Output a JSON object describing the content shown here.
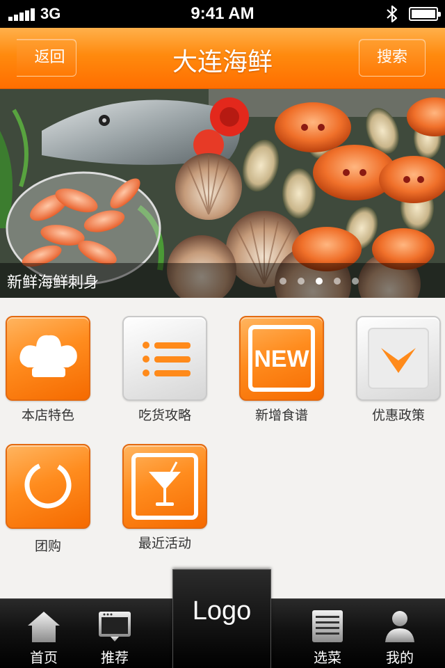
{
  "status_bar": {
    "network": "3G",
    "time": "9:41 AM",
    "icons": [
      "signal-icon",
      "bluetooth-icon",
      "battery-icon"
    ]
  },
  "nav": {
    "title": "大连海鲜",
    "back_label": "返回",
    "search_label": "搜索"
  },
  "banner": {
    "caption": "新鲜海鲜刺身",
    "slide_count": 5,
    "active_index": 3
  },
  "grid": {
    "items": [
      {
        "label": "本店特色",
        "icon": "chef-hat-icon",
        "style": "orange"
      },
      {
        "label": "吃货攻略",
        "icon": "list-icon",
        "style": "grey"
      },
      {
        "label": "新增食谱",
        "icon": "new-badge-icon",
        "icon_text": "NEW",
        "style": "orange"
      },
      {
        "label": "优惠政策",
        "icon": "chevron-down-icon",
        "style": "grey"
      },
      {
        "label": "团购",
        "icon": "ring-icon",
        "style": "orange"
      },
      {
        "label": "最近活动",
        "icon": "cocktail-icon",
        "style": "orange"
      }
    ]
  },
  "tab_bar": {
    "items": [
      {
        "label": "首页",
        "icon": "home-icon"
      },
      {
        "label": "推荐",
        "icon": "monitor-icon"
      },
      {
        "label": "选菜",
        "icon": "menu-list-icon"
      },
      {
        "label": "我的",
        "icon": "user-icon"
      }
    ],
    "logo_text": "Logo"
  },
  "colors": {
    "accent": "#ff8a0e",
    "accent_dark": "#f56a00",
    "tab_bar": "#111111",
    "page_bg": "#f3f2f0"
  }
}
